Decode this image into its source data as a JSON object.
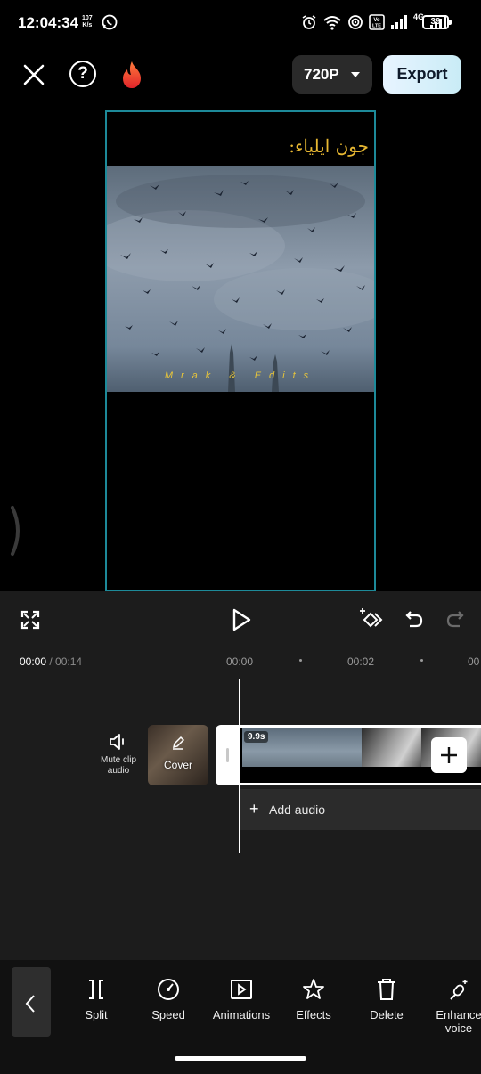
{
  "status_bar": {
    "time": "12:04:34",
    "net_speed_value": "107",
    "net_speed_unit": "K/s",
    "network_label": "4G",
    "volte_label": "Vo LTE",
    "battery": "39"
  },
  "top_bar": {
    "resolution": "720P",
    "export_label": "Export"
  },
  "preview": {
    "title_text": "جون ایلیاء:",
    "watermark": "Mrak & Edits"
  },
  "timeline": {
    "current_time": "00:00",
    "total_time": "/ 00:14",
    "ticks": [
      "00:00",
      "00:02",
      "00"
    ],
    "mute_label": "Mute clip audio",
    "cover_label": "Cover",
    "clip_duration": "9.9s",
    "add_audio_label": "Add audio"
  },
  "toolbar": {
    "items": [
      {
        "label": "Split",
        "icon": "split-icon"
      },
      {
        "label": "Speed",
        "icon": "speed-icon"
      },
      {
        "label": "Animations",
        "icon": "animations-icon"
      },
      {
        "label": "Effects",
        "icon": "effects-icon"
      },
      {
        "label": "Delete",
        "icon": "delete-icon"
      },
      {
        "label": "Enhance voice",
        "icon": "enhance-voice-icon"
      }
    ]
  },
  "colors": {
    "accent_export": "#d6f0fb",
    "preview_border": "#1d8a99",
    "title_gold": "#e8b832"
  }
}
